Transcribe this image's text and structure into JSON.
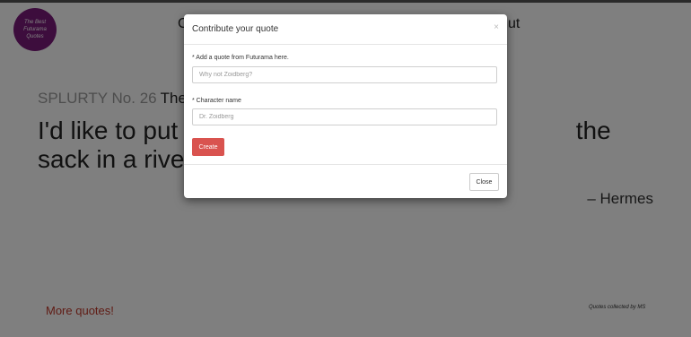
{
  "logo": {
    "lines": [
      "The Best",
      "Futurama",
      "Quotes"
    ]
  },
  "nav": {
    "fragment_left": "C",
    "fragment_right": "ut"
  },
  "headline": {
    "number_label": "SPLURTY No. 26",
    "rest": "The be"
  },
  "quote": {
    "text": "I'd like to put th                                                     the sack in a river and hurl t"
  },
  "author": "– Hermes",
  "more_quotes_label": "More quotes!",
  "footer_credit": "Quotes collected by MS",
  "modal": {
    "title": "Contribute your quote",
    "close_symbol": "×",
    "quote_field": {
      "label": "* Add a quote from Futurama here.",
      "placeholder": "Why not Zoidberg?",
      "value": ""
    },
    "character_field": {
      "label": "* Character name",
      "placeholder": "Dr. Zoidberg",
      "value": ""
    },
    "create_label": "Create",
    "close_label": "Close"
  },
  "colors": {
    "accent_red": "#d9534f",
    "logo_purple": "#7a1a7a",
    "link_red": "#c0392b"
  }
}
